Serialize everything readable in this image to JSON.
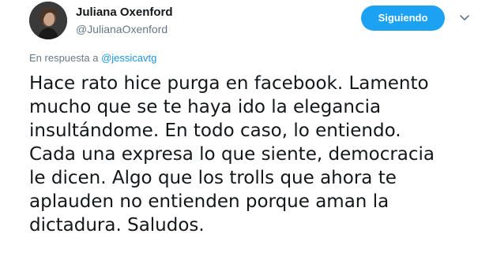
{
  "author": {
    "name": "Juliana Oxenford",
    "handle": "@JulianaOxenford",
    "avatar_icon": "profile-photo"
  },
  "follow_button": {
    "label": "Siguiendo",
    "color": "#1da1f2"
  },
  "menu_icon": "chevron-down-icon",
  "reply_context": {
    "prefix": "En respuesta a",
    "mention": "@jessicavtg",
    "mention_color": "#1b95e0"
  },
  "tweet": {
    "lines": [
      "Hace rato hice purga en facebook. Lamento",
      "mucho que se te haya ido la elegancia",
      "insultándome. En todo caso, lo entiendo.",
      "Cada una expresa lo que siente, democracia",
      "le dicen. Algo que los trolls que ahora te",
      "aplauden no entienden porque aman la",
      "dictadura. Saludos."
    ]
  }
}
